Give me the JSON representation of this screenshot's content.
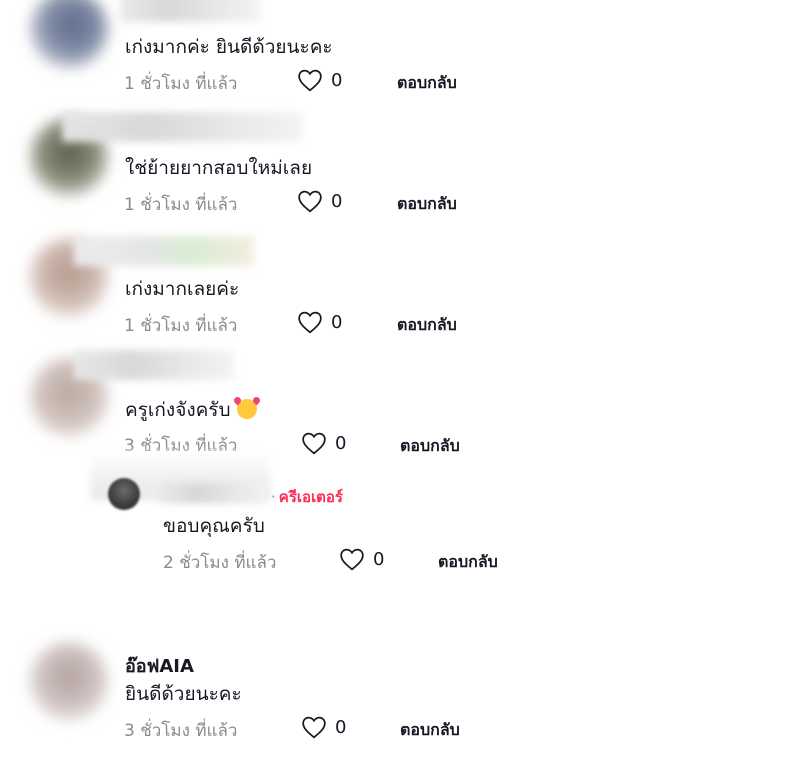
{
  "comments": [
    {
      "text": "เก่งมากค่ะ ยินดีด้วยนะคะ",
      "time": "1 ชั่วโมง ที่แล้ว",
      "likes": "0",
      "reply": "ตอบกลับ"
    },
    {
      "text": "ใช่ย้ายยากสอบใหม่เลย",
      "time": "1 ชั่วโมง ที่แล้ว",
      "likes": "0",
      "reply": "ตอบกลับ"
    },
    {
      "text": "เก่งมากเลยค่ะ",
      "time": "1 ชั่วโมง ที่แล้ว",
      "likes": "0",
      "reply": "ตอบกลับ"
    },
    {
      "text": "ครูเก่งจังครับ",
      "time": "3 ชั่วโมง ที่แล้ว",
      "likes": "0",
      "reply": "ตอบกลับ"
    },
    {
      "author": "อ๊อฟAIA",
      "text": "ยินดีด้วยนะคะ",
      "time": "3 ชั่วโมง ที่แล้ว",
      "likes": "0",
      "reply": "ตอบกลับ"
    }
  ],
  "creator_reply": {
    "dot": "·",
    "tag": "ครีเอเตอร์",
    "text": "ขอบคุณครับ",
    "time": "2 ชั่วโมง ที่แล้ว",
    "likes": "0",
    "reply": "ตอบกลับ"
  },
  "icons": {
    "like": "heart-outline-icon",
    "emoji": "smiling-face-with-hearts-icon"
  },
  "colors": {
    "creator_tag": "#fe2c55",
    "muted": "#8a8b91",
    "text": "#161823"
  }
}
